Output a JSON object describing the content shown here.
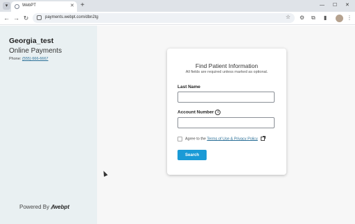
{
  "browser": {
    "tab_title": "WebPT",
    "url": "payments.webpt.com/dbn2tg",
    "icons": {
      "tab_menu": "chevron-down-icon",
      "close": "close-icon",
      "new_tab": "plus-icon",
      "back": "back-arrow-icon",
      "forward": "forward-arrow-icon",
      "reload": "reload-icon",
      "bookmark": "star-icon",
      "settings": "gear-icon",
      "extensions": "puzzle-icon",
      "side_panel": "side-panel-icon",
      "menu": "kebab-menu-icon"
    }
  },
  "sidebar": {
    "practice_name": "Georgia_test",
    "subtitle": "Online Payments",
    "phone_label": "Phone:",
    "phone_number": "(555) 666-6667",
    "powered_by": "Powered By",
    "logo_text": "webpt"
  },
  "form": {
    "title": "Find Patient Information",
    "subtitle": "All fields are required unless marked as optional.",
    "last_name_label": "Last Name",
    "last_name_value": "",
    "account_number_label": "Account Number",
    "account_number_value": "",
    "agree_text": "Agree to the",
    "terms_link": "Terms of Use & Privacy Policy",
    "agree_checked": false,
    "search_button": "Search"
  },
  "colors": {
    "accent": "#1a9ad6",
    "sidebar_bg": "#e9f0f2",
    "link": "#2a6f97"
  }
}
